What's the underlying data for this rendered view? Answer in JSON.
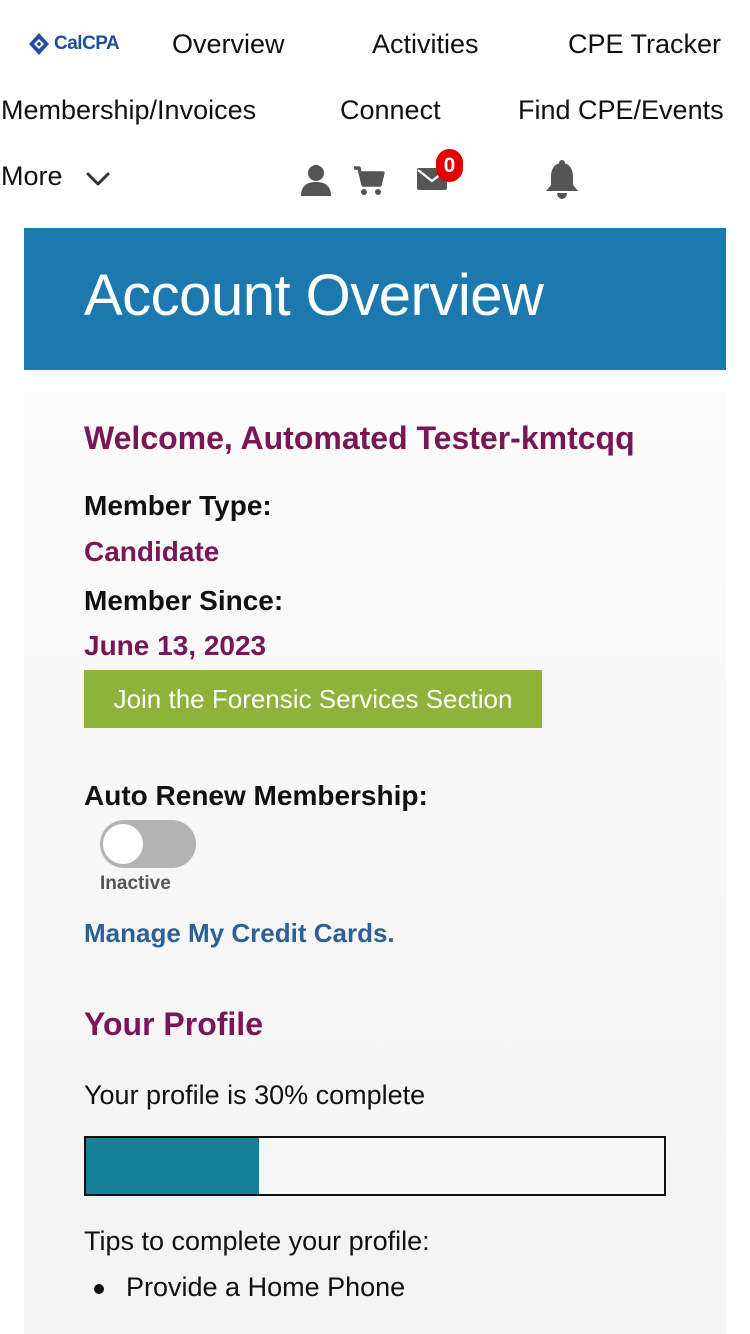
{
  "nav": {
    "logo_text": "CalCPA",
    "links": {
      "overview": "Overview",
      "activities": "Activities",
      "cpe_tracker": "CPE Tracker",
      "membership_invoices": "Membership/Invoices",
      "connect": "Connect",
      "find_cpe_events": "Find CPE/Events",
      "more": "More"
    },
    "icons": [
      "user-icon",
      "cart-icon",
      "mail-icon",
      "bell-icon"
    ],
    "mail_badge": "0"
  },
  "banner": {
    "title": "Account Overview"
  },
  "account": {
    "welcome": "Welcome, Automated Tester-kmtcqq",
    "member_type_label": "Member Type:",
    "member_type": "Candidate",
    "member_since_label": "Member Since:",
    "member_since": "June 13, 2023",
    "join_button": "Join the Forensic Services Section",
    "auto_renew_label": "Auto Renew Membership:",
    "auto_renew_status": "Inactive",
    "auto_renew_on": false,
    "manage_cards_link": "Manage My Credit Cards."
  },
  "profile": {
    "heading": "Your Profile",
    "completion_text": "Your profile is 30% complete",
    "completion_fraction": 0.3,
    "tips_heading": "Tips to complete your profile:",
    "tips": [
      "Provide a Home Phone"
    ]
  },
  "colors": {
    "brand_blue": "#1b79b0",
    "accent_maroon": "#7a1656",
    "button_green": "#8db33a",
    "link_blue": "#2d6096",
    "progress_teal": "#157f97",
    "badge_red": "#e00000"
  }
}
